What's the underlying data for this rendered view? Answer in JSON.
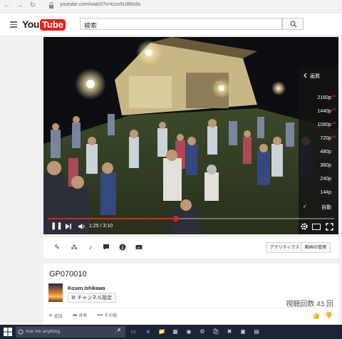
{
  "browser": {
    "url": "youtube.com/watch?v=tzzo5U8Rx8s"
  },
  "header": {
    "logo_you": "You",
    "logo_tube": "Tube",
    "search_value": "検索"
  },
  "player": {
    "time": "1:25 / 3:10",
    "progress": 0.4474,
    "quality_menu": {
      "title": "画質",
      "options": [
        "2160p",
        "1440p",
        "1080p",
        "720p",
        "480p",
        "360p",
        "240p",
        "144p",
        "自動"
      ],
      "hd_badge": "HD",
      "selected": "自動"
    }
  },
  "toolbar": {
    "analytics_label": "アナリティクス",
    "manage_label": "動画の管理"
  },
  "info": {
    "title": "GP070010",
    "channel_name": "Kosen Ishikawa",
    "channel_settings_label": "チャンネル設定",
    "views": "視聴回数 43 回",
    "actions": {
      "add": "追加",
      "share": "共有",
      "more": "その他"
    }
  },
  "taskbar": {
    "search_placeholder": "Ask me anything"
  },
  "colors": {
    "brand_red": "#e62117",
    "taskbar": "#1c2433"
  }
}
